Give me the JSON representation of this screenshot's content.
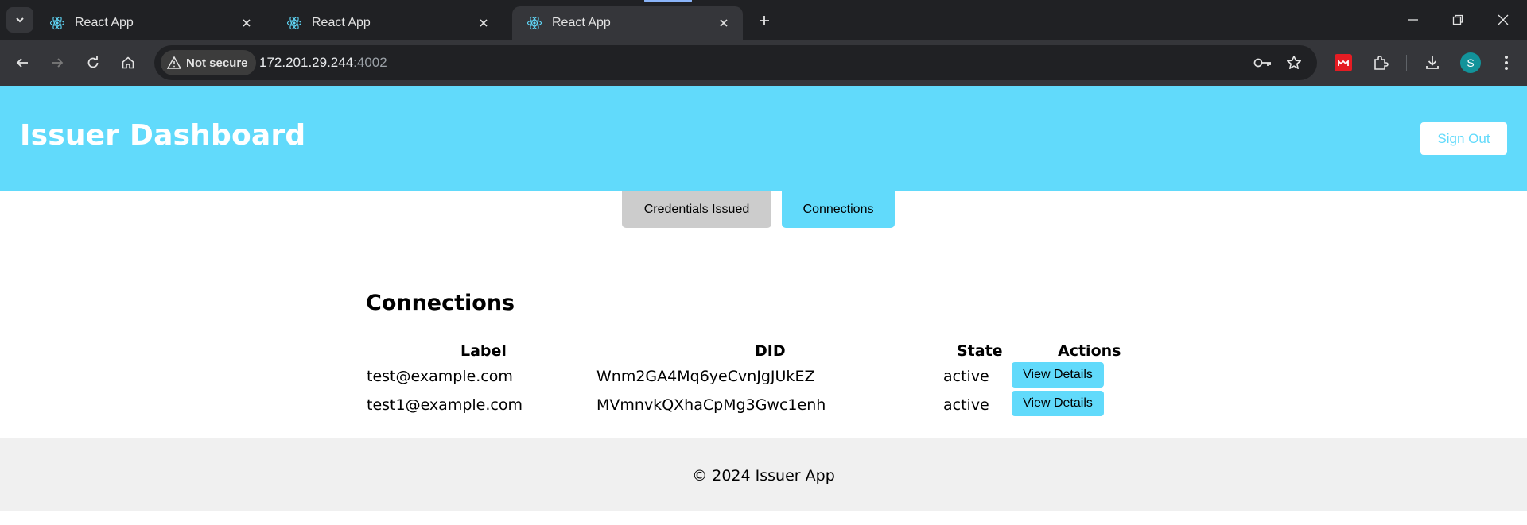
{
  "browser": {
    "tabs": [
      {
        "title": "React App",
        "active": false
      },
      {
        "title": "React App",
        "active": false
      },
      {
        "title": "React App",
        "active": true
      }
    ],
    "security_chip": "Not secure",
    "url_host": "172.201.29.244",
    "url_port": ":4002",
    "profile_initial": "S"
  },
  "header": {
    "title": "Issuer Dashboard",
    "sign_out_label": "Sign Out"
  },
  "nav_tabs": [
    {
      "label": "Credentials Issued",
      "selected": false
    },
    {
      "label": "Connections",
      "selected": true
    }
  ],
  "connections": {
    "title": "Connections",
    "columns": [
      "Label",
      "DID",
      "State",
      "Actions"
    ],
    "rows": [
      {
        "label": "test@example.com",
        "did": "Wnm2GA4Mq6yeCvnJgJUkEZ",
        "state": "active",
        "action": "View Details"
      },
      {
        "label": "test1@example.com",
        "did": "MVmnvkQXhaCpMg3Gwc1enh",
        "state": "active",
        "action": "View Details"
      }
    ]
  },
  "footer": {
    "text": "© 2024 Issuer App"
  },
  "colors": {
    "accent": "#61dafb",
    "inactive_tab": "#cccccc",
    "footer_bg": "#f0f0f0"
  }
}
